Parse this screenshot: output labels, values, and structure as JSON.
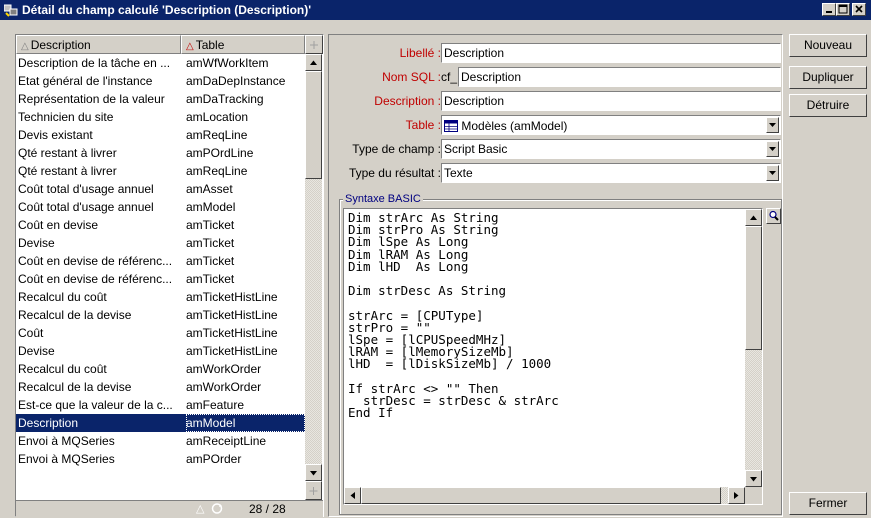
{
  "window": {
    "title": "Détail du champ calculé 'Description (Description)'"
  },
  "list": {
    "columns": [
      "Description",
      "Table"
    ],
    "rows": [
      {
        "description": "Description de la tâche en ...",
        "table": "amWfWorkItem"
      },
      {
        "description": "Etat général de l'instance",
        "table": "amDaDepInstance"
      },
      {
        "description": "Représentation de la valeur",
        "table": "amDaTracking"
      },
      {
        "description": "Technicien du site",
        "table": "amLocation"
      },
      {
        "description": "Devis existant",
        "table": "amReqLine"
      },
      {
        "description": "Qté restant à livrer",
        "table": "amPOrdLine"
      },
      {
        "description": "Qté restant à livrer",
        "table": "amReqLine"
      },
      {
        "description": "Coût total d'usage annuel",
        "table": "amAsset"
      },
      {
        "description": "Coût total d'usage annuel",
        "table": "amModel"
      },
      {
        "description": "Coût en devise",
        "table": "amTicket"
      },
      {
        "description": "Devise",
        "table": "amTicket"
      },
      {
        "description": "Coût en devise de référenc...",
        "table": "amTicket"
      },
      {
        "description": "Coût en devise de référenc...",
        "table": "amTicket"
      },
      {
        "description": "Recalcul du coût",
        "table": "amTicketHistLine"
      },
      {
        "description": "Recalcul de la devise",
        "table": "amTicketHistLine"
      },
      {
        "description": "Coût",
        "table": "amTicketHistLine"
      },
      {
        "description": "Devise",
        "table": "amTicketHistLine"
      },
      {
        "description": "Recalcul du coût",
        "table": "amWorkOrder"
      },
      {
        "description": "Recalcul de la devise",
        "table": "amWorkOrder"
      },
      {
        "description": "Est-ce que la valeur de la c...",
        "table": "amFeature"
      },
      {
        "description": "Description",
        "table": "amModel",
        "selected": true
      },
      {
        "description": "Envoi à MQSeries",
        "table": "amReceiptLine"
      },
      {
        "description": "Envoi à MQSeries",
        "table": "amPOrder"
      }
    ],
    "counter": "28 / 28",
    "selected_index": 20
  },
  "form": {
    "libelle_label": "Libellé :",
    "libelle_value": "Description",
    "nomsql_label": "Nom SQL :",
    "nomsql_prefix": "cf_",
    "nomsql_value": "Description",
    "description_label": "Description :",
    "description_value": "Description",
    "table_label": "Table :",
    "table_value": "Modèles (amModel)",
    "typechamp_label": "Type de champ :",
    "typechamp_value": "Script Basic",
    "typeresultat_label": "Type du résultat :",
    "typeresultat_value": "Texte",
    "syntax_group_title": "Syntaxe BASIC",
    "code": "Dim strArc As String\nDim strPro As String\nDim lSpe As Long\nDim lRAM As Long\nDim lHD  As Long\n\nDim strDesc As String\n\nstrArc = [CPUType]\nstrPro = \"\"\nlSpe = [lCPUSpeedMHz]\nlRAM = [lMemorySizeMb]\nlHD  = [lDiskSizeMb] / 1000\n\nIf strArc <> \"\" Then\n  strDesc = strDesc & strArc\nEnd If"
  },
  "buttons": {
    "nouveau": "Nouveau",
    "dupliquer": "Dupliquer",
    "detruire": "Détruire",
    "fermer": "Fermer"
  },
  "colors": {
    "titlebar": "#0a246a",
    "required_label": "#c00000",
    "face": "#d4d0c8"
  }
}
